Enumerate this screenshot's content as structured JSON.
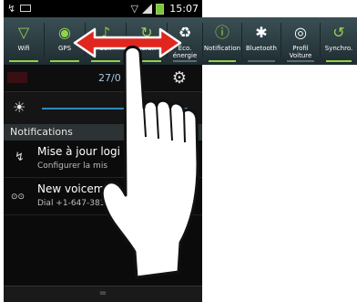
{
  "status_bar": {
    "time": "15:07"
  },
  "toggles": [
    {
      "label": "Wifi",
      "icon": "wifi-icon",
      "glyph": "▽",
      "on": true
    },
    {
      "label": "GPS",
      "icon": "gps-icon",
      "glyph": "◉",
      "on": true
    },
    {
      "label": "Son",
      "icon": "sound-icon",
      "glyph": "♪",
      "on": true
    },
    {
      "label": "Écran",
      "icon": "screen-rotation-icon",
      "glyph": "↻",
      "on": true
    },
    {
      "label": "Éco. énergie",
      "icon": "power-saving-icon",
      "glyph": "♻",
      "on": false
    },
    {
      "label": "Notification",
      "icon": "notification-icon",
      "glyph": "ⓘ",
      "on": true
    },
    {
      "label": "Bluetooth",
      "icon": "bluetooth-icon",
      "glyph": "✱",
      "on": false
    },
    {
      "label": "Profil Voiture",
      "icon": "car-profile-icon",
      "glyph": "◎",
      "on": false
    },
    {
      "label": "Synchro.",
      "icon": "sync-icon",
      "glyph": "↺",
      "on": true
    }
  ],
  "date_row": {
    "date": "27/0   2"
  },
  "notifications_header": "Notifications",
  "notifications": [
    {
      "title": "Mise à jour logi",
      "subtitle": "Configurer la mis",
      "icon": "update-icon",
      "glyph": "↯"
    },
    {
      "title": "New voicema",
      "subtitle": "Dial +1-647-383-",
      "icon": "voicemail-icon",
      "glyph": "⊙⊙"
    }
  ],
  "handle_glyph": "="
}
